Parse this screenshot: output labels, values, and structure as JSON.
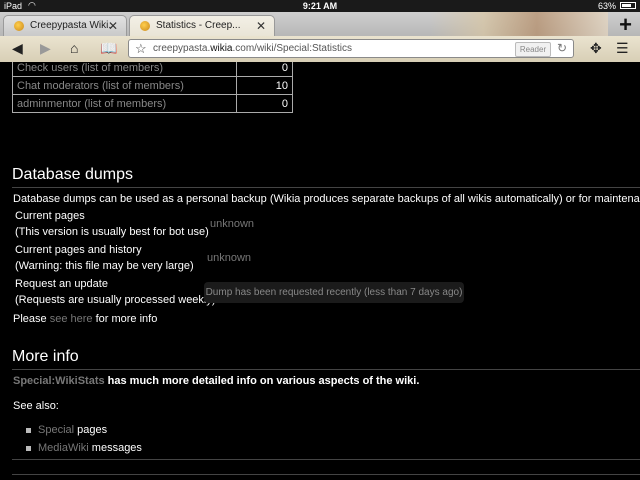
{
  "status": {
    "carrier": "iPad",
    "time": "9:21 AM",
    "battery": "63%"
  },
  "tabs": [
    {
      "label": "Creepypasta Wiki...",
      "active": false
    },
    {
      "label": "Statistics - Creep...",
      "active": true
    }
  ],
  "toolbar": {
    "url_prefix": "creepypasta.",
    "url_domain": "wikia",
    "url_suffix": ".com/wiki/Special:Statistics",
    "reader_label": "Reader"
  },
  "members_table": [
    {
      "name": "Check users (list of members)",
      "value": "0"
    },
    {
      "name": "Chat moderators (list of members)",
      "value": "10"
    },
    {
      "name": "adminmentor (list of members)",
      "value": "0"
    }
  ],
  "dumps": {
    "heading": "Database dumps",
    "intro": "Database dumps can be used as a personal backup (Wikia produces separate backups of all wikis automatically) or for maintenance bots",
    "rows": [
      {
        "title": "Current pages",
        "note": "(This version is usually best for bot use)",
        "status": "unknown"
      },
      {
        "title": "Current pages and history",
        "note": "(Warning: this file may be very large)",
        "status": "unknown"
      },
      {
        "title": "Request an update",
        "note": "(Requests are usually processed weekly)",
        "status": "Dump has been requested recently (less than 7 days ago)"
      }
    ],
    "please_prefix": "Please ",
    "please_link": "see here",
    "please_suffix": " for more info"
  },
  "more_info": {
    "heading": "More info",
    "wikistats_link": "Special:WikiStats",
    "wikistats_text": " has much more detailed info on various aspects of the wiki.",
    "see_also": "See also:",
    "list": [
      {
        "link": "Special",
        "text": " pages"
      },
      {
        "link": "MediaWiki",
        "text": " messages"
      }
    ]
  }
}
